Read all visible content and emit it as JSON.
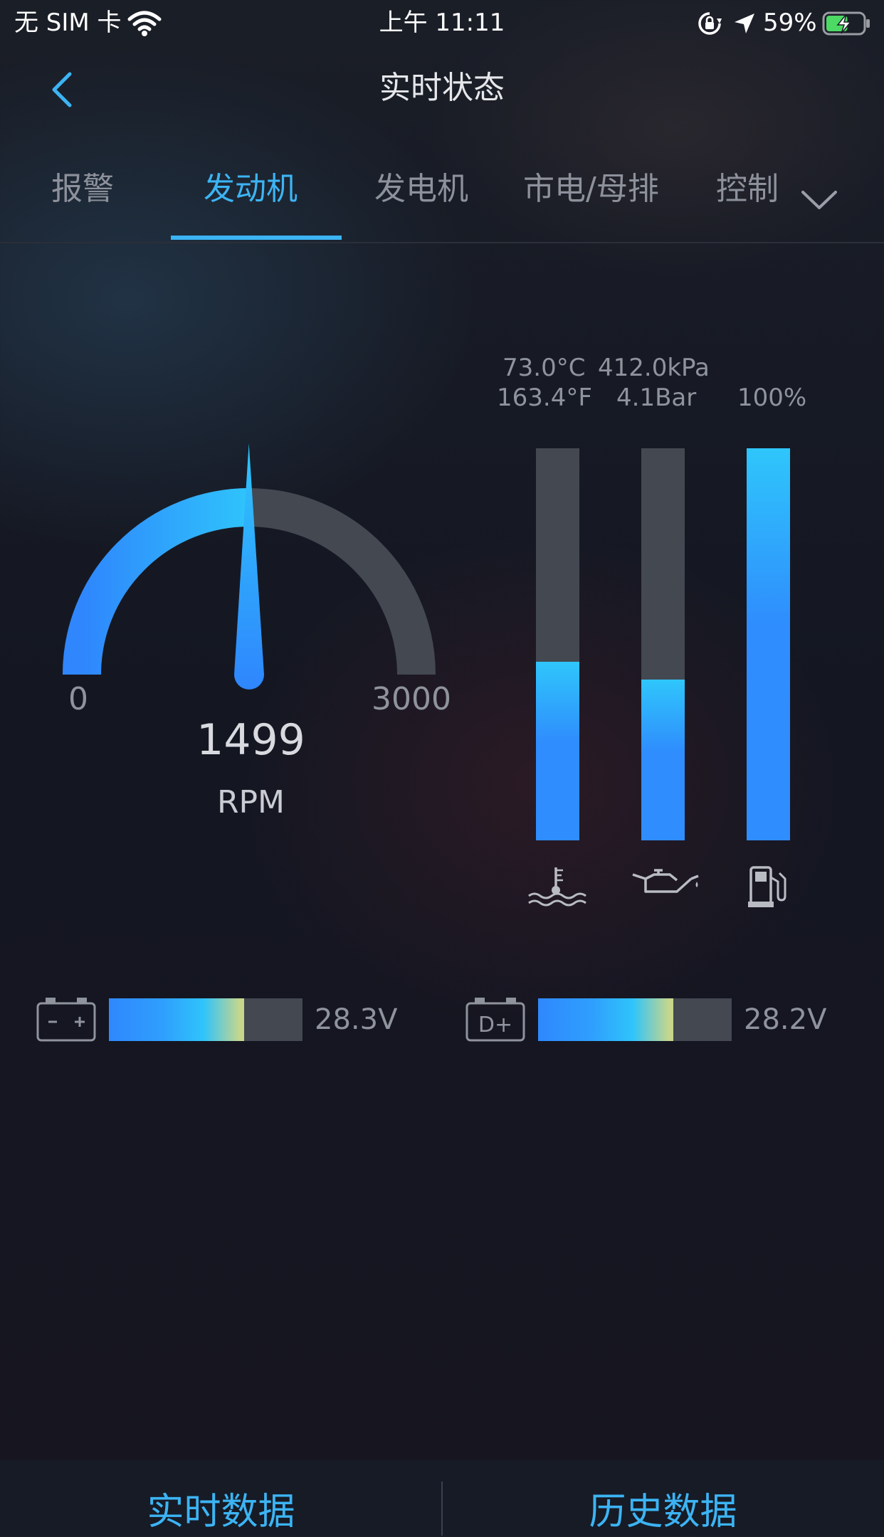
{
  "status_bar": {
    "carrier": "无 SIM 卡",
    "time": "上午 11:11",
    "battery_percent": "59%",
    "battery_level": 0.59,
    "icons": [
      "wifi-icon",
      "rotation-lock-icon",
      "location-arrow-icon",
      "battery-charging-icon"
    ]
  },
  "header": {
    "back_icon": "chevron-left-icon",
    "title": "实时状态"
  },
  "tabs": {
    "items": [
      {
        "label": "报警",
        "active": false
      },
      {
        "label": "发动机",
        "active": true
      },
      {
        "label": "发电机",
        "active": false
      },
      {
        "label": "市电/母排",
        "active": false
      },
      {
        "label": "控制",
        "active": false
      }
    ],
    "more_icon": "chevron-down-icon"
  },
  "gauge": {
    "min_label": "0",
    "max_label": "3000",
    "min": 0,
    "max": 3000,
    "value": 1499,
    "value_label": "1499",
    "unit": "RPM"
  },
  "readings": {
    "temperature_c": "73.0°C",
    "temperature_f": "163.4°F",
    "oil_kpa": "412.0kPa",
    "oil_bar": "4.1Bar",
    "fuel": "100%"
  },
  "bars": [
    {
      "name": "coolant-temperature",
      "icon": "coolant-temperature-icon",
      "level": 0.455
    },
    {
      "name": "oil-pressure",
      "icon": "oil-can-icon",
      "level": 0.41
    },
    {
      "name": "fuel",
      "icon": "fuel-pump-icon",
      "level": 1.0
    }
  ],
  "voltages": [
    {
      "icon": "battery-icon",
      "value": "28.3V",
      "level": 0.7
    },
    {
      "icon": "alternator-d-plus-icon",
      "value": "28.2V",
      "level": 0.7
    }
  ],
  "bottom_nav": {
    "realtime_label": "实时数据",
    "history_label": "历史数据"
  },
  "colors": {
    "accent": "#3cb4f4",
    "gauge_fill": "#2f8dfd",
    "track": "#434851"
  }
}
